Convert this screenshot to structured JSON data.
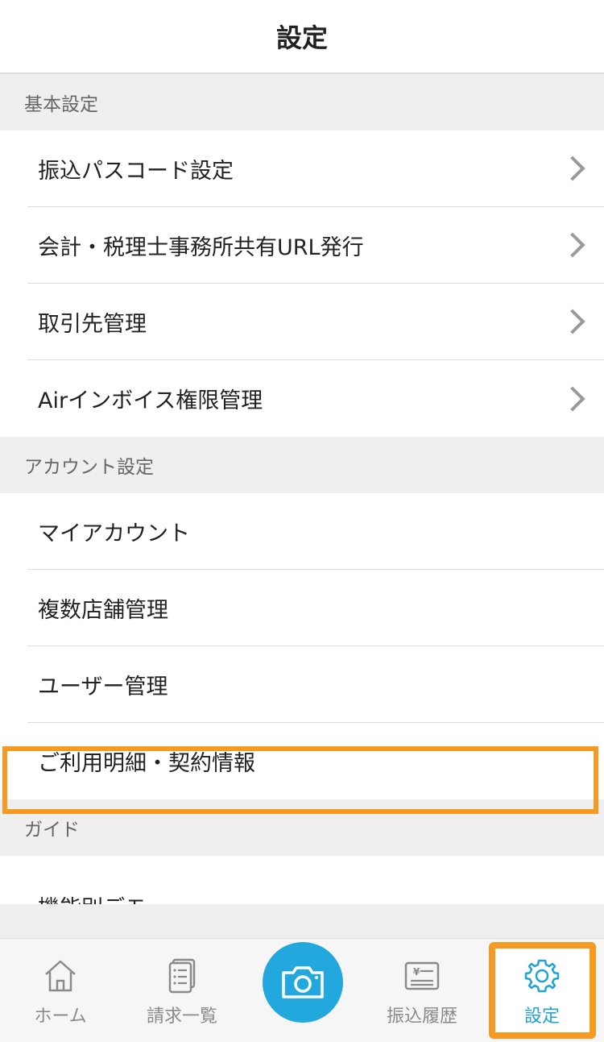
{
  "header": {
    "title": "設定"
  },
  "sections": [
    {
      "title": "基本設定",
      "items": [
        {
          "label": "振込パスコード設定"
        },
        {
          "label": "会計・税理士事務所共有URL発行"
        },
        {
          "label": "取引先管理"
        },
        {
          "label": "Airインボイス権限管理"
        }
      ]
    },
    {
      "title": "アカウント設定",
      "items": [
        {
          "label": "マイアカウント"
        },
        {
          "label": "複数店舗管理"
        },
        {
          "label": "ユーザー管理"
        },
        {
          "label": "ご利用明細・契約情報"
        }
      ]
    },
    {
      "title": "ガイド",
      "items": [
        {
          "label": "機能別デモ"
        }
      ]
    }
  ],
  "tabbar": {
    "home": "ホーム",
    "invoices": "請求一覧",
    "camera": "camera-icon",
    "transfer_history": "振込履歴",
    "settings": "設定"
  },
  "colors": {
    "accent": "#22a8dc",
    "highlight": "#f59a23"
  }
}
